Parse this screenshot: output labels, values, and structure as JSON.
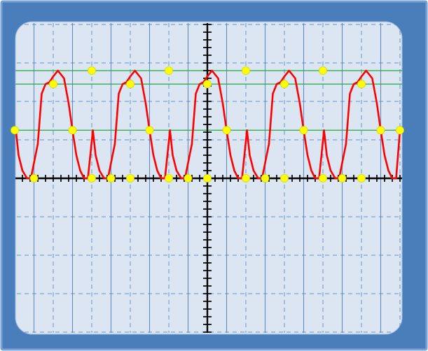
{
  "chart_data": {
    "type": "line",
    "title": "",
    "xlabel": "",
    "ylabel": "",
    "xlim": [
      -5,
      5
    ],
    "ylim": [
      -4,
      4
    ],
    "grid": true,
    "axes": "centered-crosshair",
    "series": [
      {
        "color": "#ff0000",
        "x": [
          -4.97,
          -4.9,
          -4.8,
          -4.68,
          -4.58,
          -4.52,
          -4.4,
          -4.3,
          -4.2,
          -4.1,
          -4.0,
          -3.88,
          -3.72,
          -3.6,
          -3.5,
          -3.4,
          -3.3,
          -3.2,
          -3.1,
          -2.97,
          -2.9,
          -2.8,
          -2.68,
          -2.58,
          -2.52,
          -2.4,
          -2.3,
          -2.2,
          -2.1,
          -2.0,
          -1.88,
          -1.72,
          -1.6,
          -1.5,
          -1.4,
          -1.3,
          -1.2,
          -1.1,
          -0.97,
          -0.9,
          -0.8,
          -0.68,
          -0.58,
          -0.52,
          -0.4,
          -0.3,
          -0.2,
          -0.1,
          0.0,
          0.12,
          0.28,
          0.4,
          0.5,
          0.6,
          0.7,
          0.8,
          0.9,
          1.03,
          1.1,
          1.2,
          1.32,
          1.42,
          1.48,
          1.6,
          1.7,
          1.8,
          1.9,
          2.0,
          2.12,
          2.28,
          2.4,
          2.5,
          2.6,
          2.7,
          2.8,
          2.9,
          3.03,
          3.1,
          3.2,
          3.32,
          3.42,
          3.48,
          3.6,
          3.7,
          3.8,
          3.9,
          4.0,
          4.12,
          4.28,
          4.4,
          4.5,
          4.6,
          4.7,
          4.8,
          4.9,
          5.0
        ],
        "y": [
          1.25,
          0.6,
          0.2,
          0.0,
          0.0,
          0.3,
          0.9,
          2.2,
          2.45,
          2.5,
          2.65,
          2.8,
          2.6,
          1.95,
          1.25,
          0.6,
          0.2,
          0.0,
          0.0,
          1.25,
          0.6,
          0.2,
          0.0,
          0.0,
          0.3,
          0.9,
          2.2,
          2.45,
          2.5,
          2.65,
          2.8,
          2.6,
          1.95,
          1.25,
          0.6,
          0.2,
          0.0,
          0.0,
          1.25,
          0.6,
          0.2,
          0.0,
          0.0,
          0.3,
          0.9,
          2.2,
          2.45,
          2.5,
          2.65,
          2.8,
          2.6,
          1.95,
          1.25,
          0.6,
          0.2,
          0.0,
          0.0,
          1.25,
          0.6,
          0.2,
          0.0,
          0.0,
          0.3,
          0.9,
          2.2,
          2.45,
          2.5,
          2.65,
          2.8,
          2.6,
          1.95,
          1.25,
          0.6,
          0.2,
          0.0,
          0.0,
          1.25,
          0.6,
          0.2,
          0.0,
          0.0,
          0.3,
          0.9,
          2.2,
          2.45,
          2.5,
          2.65,
          2.8,
          2.6,
          1.95,
          1.25,
          0.6,
          0.2,
          0.0,
          0.0,
          1.25
        ]
      }
    ],
    "markers": {
      "color": "#ffff00",
      "x": [
        -5.0,
        -4.5,
        -4.0,
        -3.5,
        -3.0,
        -2.5,
        -2.0,
        -1.5,
        -1.0,
        -0.5,
        0.0,
        0.5,
        1.0,
        1.5,
        2.0,
        2.5,
        3.0,
        3.5,
        4.0,
        4.5,
        5.0,
        -3.0,
        -2.0,
        -1.0,
        0.0,
        1.0,
        2.0,
        3.0,
        4.0
      ],
      "y": [
        1.25,
        0.0,
        2.45,
        1.25,
        2.8,
        0.0,
        2.45,
        1.25,
        2.8,
        0.0,
        2.45,
        1.25,
        2.8,
        0.0,
        2.45,
        1.25,
        2.8,
        0.0,
        2.45,
        1.25,
        1.25,
        0.0,
        0.0,
        0.0,
        0.0,
        0.0,
        0.0,
        0.0,
        0.0
      ]
    },
    "reference_lines": {
      "color": "#22aa44",
      "y": [
        2.8,
        2.45,
        1.25
      ]
    },
    "colors": {
      "frame": "#4a7ebb",
      "frame_border": "#7aa2d4",
      "screen": "#dce6f2",
      "solid_grid": "#4a7ebb",
      "dashed_grid": "#4a7ebb",
      "axes": "#000000"
    }
  }
}
